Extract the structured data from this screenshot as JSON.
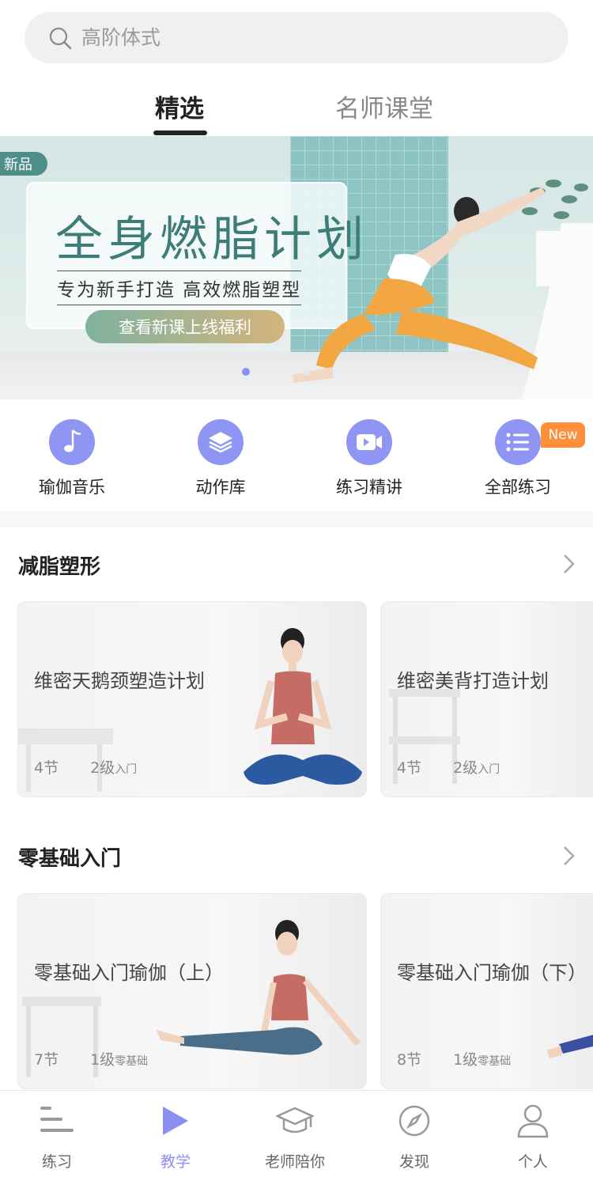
{
  "search": {
    "placeholder": "高阶体式"
  },
  "tabs": [
    {
      "label": "精选",
      "active": true
    },
    {
      "label": "名师课堂",
      "active": false
    }
  ],
  "banner": {
    "tag": "新品",
    "title": "全身燃脂计划",
    "subtitle": "专为新手打造 高效燃脂塑型",
    "button": "查看新课上线福利",
    "dots": 2,
    "active_dot": 0
  },
  "categories": [
    {
      "label": "瑜伽音乐",
      "icon": "music-note-icon"
    },
    {
      "label": "动作库",
      "icon": "layers-icon"
    },
    {
      "label": "练习精讲",
      "icon": "video-icon"
    },
    {
      "label": "全部练习",
      "icon": "list-icon",
      "badge": "New"
    }
  ],
  "sections": [
    {
      "title": "减脂塑形",
      "cards": [
        {
          "name": "维密天鹅颈塑造计划",
          "sessions": "4节",
          "level": "2级",
          "level_note": "入门"
        },
        {
          "name": "维密美背打造计划",
          "sessions": "4节",
          "level": "2级",
          "level_note": "入门"
        }
      ]
    },
    {
      "title": "零基础入门",
      "cards": [
        {
          "name": "零基础入门瑜伽（上）",
          "sessions": "7节",
          "level": "1级",
          "level_note": "零基础"
        },
        {
          "name": "零基础入门瑜伽（下）",
          "sessions": "8节",
          "level": "1级",
          "level_note": "零基础"
        }
      ]
    }
  ],
  "nav": [
    {
      "label": "练习",
      "icon": "practice-bars-icon",
      "active": false
    },
    {
      "label": "教学",
      "icon": "play-icon",
      "active": true
    },
    {
      "label": "老师陪你",
      "icon": "graduation-cap-icon",
      "active": false
    },
    {
      "label": "发现",
      "icon": "compass-icon",
      "active": false
    },
    {
      "label": "个人",
      "icon": "person-icon",
      "active": false
    }
  ],
  "colors": {
    "accent": "#8a90ef",
    "badge": "#ff8f3a",
    "banner_title": "#3d7d77"
  }
}
